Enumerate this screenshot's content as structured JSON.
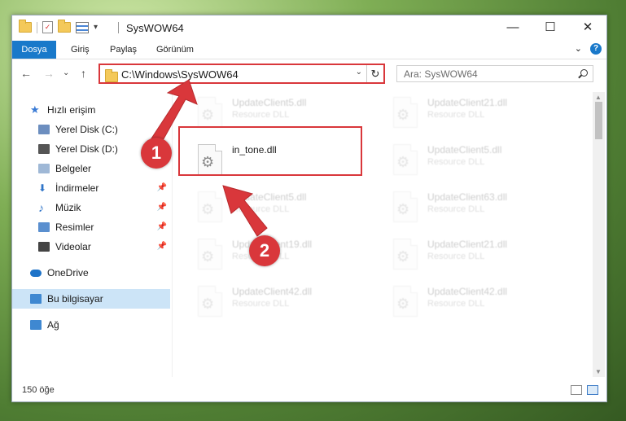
{
  "window": {
    "title": "SysWOW64",
    "controls": {
      "minimize": "—",
      "maximize": "☐",
      "close": "✕"
    }
  },
  "quick_access_toolbar": {
    "dropdown": "▾"
  },
  "ribbon": {
    "tabs": [
      "Dosya",
      "Giriş",
      "Paylaş",
      "Görünüm"
    ],
    "expand": "⌄",
    "help": "?"
  },
  "navigation": {
    "back": "←",
    "forward": "→",
    "recent": "⌄",
    "up": "↑",
    "address": "C:\\Windows\\SysWOW64",
    "address_dropdown": "⌄",
    "refresh": "↻",
    "search_placeholder": "Ara: SysWOW64"
  },
  "sidebar": {
    "items": [
      {
        "label": "Hızlı erişim",
        "icon": "star-icon",
        "color": "#3a7bd5"
      },
      {
        "label": "Yerel Disk (C:)",
        "icon": "drive-icon",
        "color": "#6c8ebf",
        "pinned": true
      },
      {
        "label": "Yerel Disk (D:)",
        "icon": "drive-icon",
        "color": "#555555",
        "pinned": true
      },
      {
        "label": "Belgeler",
        "icon": "documents-icon",
        "color": "#9fb8d6"
      },
      {
        "label": "İndirmeler",
        "icon": "download-icon",
        "color": "#2f74c8",
        "pinned": true
      },
      {
        "label": "Müzik",
        "icon": "music-icon",
        "color": "#2f74c8",
        "pinned": true
      },
      {
        "label": "Resimler",
        "icon": "pictures-icon",
        "color": "#5a8fcf",
        "pinned": true
      },
      {
        "label": "Videolar",
        "icon": "videos-icon",
        "color": "#444444",
        "pinned": true
      },
      {
        "label": "OneDrive",
        "icon": "cloud-icon",
        "color": "#1e73c8"
      },
      {
        "label": "Bu bilgisayar",
        "icon": "computer-icon",
        "color": "#3f88d1",
        "selected": true
      },
      {
        "label": "Ağ",
        "icon": "network-icon",
        "color": "#3f88d1"
      }
    ],
    "pin_glyph": "📌"
  },
  "files": [
    {
      "name": "UpdateClient5.dll",
      "desc": "Resource DLL",
      "faded": true
    },
    {
      "name": "UpdateClient21.dll",
      "desc": "Resource DLL",
      "faded": true
    },
    {
      "name": "in_tone.dll",
      "desc": "",
      "faded": false
    },
    {
      "name": "UpdateClient5.dll",
      "desc": "Resource DLL",
      "faded": true
    },
    {
      "name": "UpdateClient5.dll",
      "desc": "Resource DLL",
      "faded": true
    },
    {
      "name": "UpdateClient63.dll",
      "desc": "Resource DLL",
      "faded": true
    },
    {
      "name": "UpdateClient19.dll",
      "desc": "Resource DLL",
      "faded": true
    },
    {
      "name": "UpdateClient21.dll",
      "desc": "Resource DLL",
      "faded": true
    },
    {
      "name": "UpdateClient42.dll",
      "desc": "Resource DLL",
      "faded": true
    },
    {
      "name": "UpdateClient42.dll",
      "desc": "Resource DLL",
      "faded": true
    }
  ],
  "status": {
    "item_count": "150 öğe"
  },
  "scroll": {
    "up": "▲",
    "down": "▼"
  },
  "callouts": {
    "step1": "1",
    "step2": "2"
  },
  "accent_color": "#d9373b",
  "ribbon_color": "#1979ca"
}
